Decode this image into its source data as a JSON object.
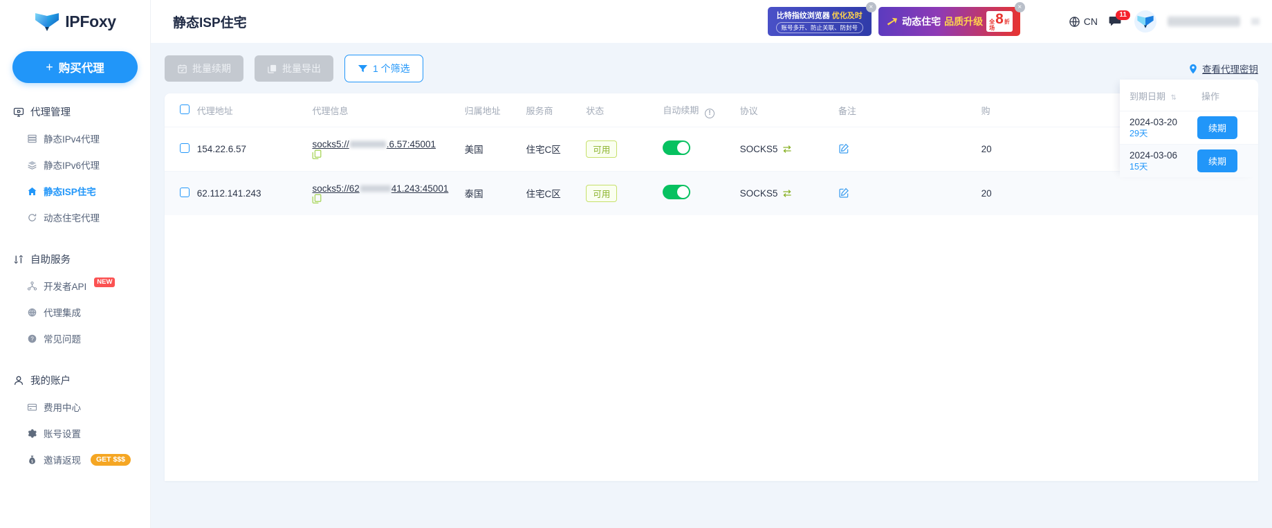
{
  "brand": {
    "name": "IPFoxy",
    "logo_icon": "fox-logo-icon"
  },
  "sidebar": {
    "buy_button": {
      "label": "购买代理",
      "plus": "+"
    },
    "groups": [
      {
        "title": "代理管理",
        "icon": "monitor-icon",
        "items": [
          {
            "label": "静态IPv4代理",
            "icon": "server-icon",
            "active": false
          },
          {
            "label": "静态IPv6代理",
            "icon": "layers-icon",
            "active": false
          },
          {
            "label": "静态ISP住宅",
            "icon": "home-icon",
            "active": true
          },
          {
            "label": "动态住宅代理",
            "icon": "refresh-icon",
            "active": false
          }
        ]
      },
      {
        "title": "自助服务",
        "icon": "sync-icon",
        "items": [
          {
            "label": "开发者API",
            "icon": "api-icon",
            "badge": "NEW",
            "active": false
          },
          {
            "label": "代理集成",
            "icon": "globe-grid-icon",
            "active": false
          },
          {
            "label": "常见问题",
            "icon": "question-icon",
            "active": false
          }
        ]
      },
      {
        "title": "我的账户",
        "icon": "user-icon",
        "items": [
          {
            "label": "费用中心",
            "icon": "card-icon",
            "active": false
          },
          {
            "label": "账号设置",
            "icon": "gear-icon",
            "active": false
          },
          {
            "label": "邀请返现",
            "icon": "money-bag-icon",
            "badge": "GET $$$",
            "active": false
          }
        ]
      }
    ]
  },
  "header": {
    "title": "静态ISP住宅",
    "language": {
      "label": "CN",
      "icon": "globe-icon"
    },
    "messages": {
      "count": "11",
      "icon": "chat-icon"
    },
    "avatar_icon": "fox-avatar-icon",
    "ads": [
      {
        "line1_a": "比特指纹浏览器",
        "line1_b": "优化及时",
        "line2": "账号多开、防止关联、防封号",
        "close": "×"
      },
      {
        "text1": "动态住宅",
        "text2": "品质升级",
        "discount_small_top": "全",
        "discount_small_bottom": "场",
        "discount_big": "8",
        "discount_unit": "折",
        "close": "×"
      }
    ]
  },
  "toolbar": {
    "batch_renew": {
      "label": "批量续期",
      "icon": "calendar-icon",
      "disabled": true
    },
    "batch_export": {
      "label": "批量导出",
      "icon": "copy-icon",
      "disabled": true
    },
    "filter": {
      "label": "1 个筛选",
      "icon": "filter-icon"
    },
    "view_key": {
      "label": "查看代理密钥",
      "icon": "location-pin-icon"
    }
  },
  "table": {
    "columns": [
      "代理地址",
      "代理信息",
      "归属地址",
      "服务商",
      "状态",
      "自动续期",
      "协议",
      "备注",
      "购"
    ],
    "auto_renew_info_icon": "info-icon",
    "rows": [
      {
        "address": "154.22.6.57",
        "info_prefix": "socks5://",
        "info_suffix": ".6.57:45001",
        "region": "美国",
        "isp": "住宅C区",
        "status": "可用",
        "auto_renew": true,
        "protocol": "SOCKS5",
        "note_icon": "edit-icon",
        "purchase_partial": "20"
      },
      {
        "address": "62.112.141.243",
        "info_prefix": "socks5://62",
        "info_suffix": "41.243:45001",
        "region": "泰国",
        "isp": "住宅C区",
        "status": "可用",
        "auto_renew": true,
        "protocol": "SOCKS5",
        "note_icon": "edit-icon",
        "purchase_partial": "20"
      }
    ]
  },
  "fixed_panel": {
    "date_header": "到期日期",
    "action_header": "操作",
    "rows": [
      {
        "date": "2024-03-20",
        "remaining": "29天",
        "button": "续期"
      },
      {
        "date": "2024-03-06",
        "remaining": "15天",
        "button": "续期"
      }
    ]
  }
}
